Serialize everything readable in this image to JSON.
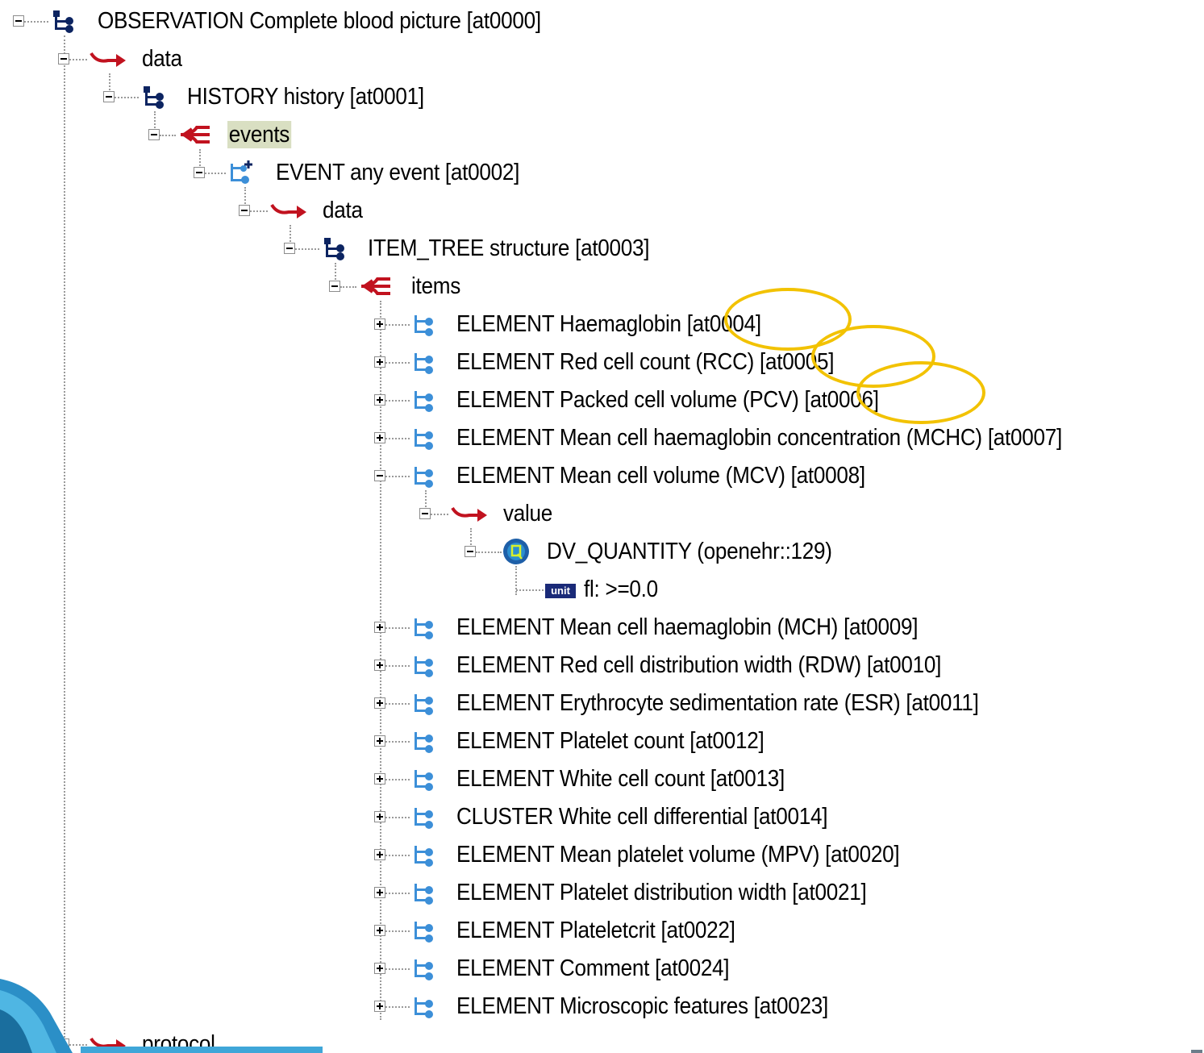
{
  "tree": {
    "nodes": [
      {
        "label": "OBSERVATION Complete blood picture [at0000]",
        "icon": "tree-structure-icon",
        "state": "expanded"
      },
      {
        "label": "data",
        "icon": "red-arrow-icon",
        "state": "expanded"
      },
      {
        "label": "HISTORY history [at0001]",
        "icon": "tree-structure-icon",
        "state": "expanded"
      },
      {
        "label": "events",
        "icon": "red-branch-icon",
        "state": "expanded",
        "highlighted": true
      },
      {
        "label": "EVENT any event [at0002]",
        "icon": "event-structure-icon",
        "state": "expanded"
      },
      {
        "label": "data",
        "icon": "red-arrow-icon",
        "state": "expanded"
      },
      {
        "label": "ITEM_TREE structure [at0003]",
        "icon": "tree-structure-icon",
        "state": "expanded"
      },
      {
        "label": "items",
        "icon": "red-branch-icon",
        "state": "expanded"
      },
      {
        "label": "ELEMENT Haemaglobin [at0004]",
        "icon": "element-structure-icon",
        "state": "collapsed"
      },
      {
        "label": "ELEMENT Red cell count (RCC) [at0005]",
        "icon": "element-structure-icon",
        "state": "collapsed"
      },
      {
        "label": "ELEMENT Packed cell volume (PCV) [at0006]",
        "icon": "element-structure-icon",
        "state": "collapsed"
      },
      {
        "label": "ELEMENT Mean cell haemaglobin concentration (MCHC) [at0007]",
        "icon": "element-structure-icon",
        "state": "collapsed"
      },
      {
        "label": "ELEMENT Mean cell volume (MCV) [at0008]",
        "icon": "element-structure-icon",
        "state": "expanded"
      },
      {
        "label": "value",
        "icon": "red-arrow-icon",
        "state": "expanded"
      },
      {
        "label": "DV_QUANTITY (openehr::129)",
        "icon": "quantity-q-icon",
        "state": "expanded"
      },
      {
        "label": "fl: >=0.0",
        "icon": "unit-badge-icon",
        "badge": "unit",
        "state": "leaf"
      },
      {
        "label": "ELEMENT Mean cell haemaglobin (MCH) [at0009]",
        "icon": "element-structure-icon",
        "state": "collapsed"
      },
      {
        "label": "ELEMENT Red cell distribution width (RDW) [at0010]",
        "icon": "element-structure-icon",
        "state": "collapsed"
      },
      {
        "label": "ELEMENT Erythrocyte sedimentation rate (ESR) [at0011]",
        "icon": "element-structure-icon",
        "state": "collapsed"
      },
      {
        "label": "ELEMENT Platelet count [at0012]",
        "icon": "element-structure-icon",
        "state": "collapsed"
      },
      {
        "label": "ELEMENT White cell count [at0013]",
        "icon": "element-structure-icon",
        "state": "collapsed"
      },
      {
        "label": "CLUSTER White cell differential [at0014]",
        "icon": "element-structure-icon",
        "state": "collapsed"
      },
      {
        "label": "ELEMENT Mean platelet volume (MPV) [at0020]",
        "icon": "element-structure-icon",
        "state": "collapsed"
      },
      {
        "label": "ELEMENT Platelet distribution width [at0021]",
        "icon": "element-structure-icon",
        "state": "collapsed"
      },
      {
        "label": "ELEMENT Plateletcrit [at0022]",
        "icon": "element-structure-icon",
        "state": "collapsed"
      },
      {
        "label": "ELEMENT Comment [at0024]",
        "icon": "element-structure-icon",
        "state": "collapsed"
      },
      {
        "label": "ELEMENT Microscopic features [at0023]",
        "icon": "element-structure-icon",
        "state": "collapsed"
      },
      {
        "label": "protocol",
        "icon": "red-arrow-icon",
        "state": "expanded"
      }
    ]
  },
  "annotations": {
    "highlight_color": "#f2c200",
    "circled_codes": [
      "[at0004]",
      "[at0005]",
      "[at0006]"
    ]
  },
  "colors": {
    "selection_bg": "#d9dfc2",
    "arrow_red": "#c1121f",
    "node_dark_blue": "#0c2461",
    "node_light_blue": "#3c8fd8"
  }
}
